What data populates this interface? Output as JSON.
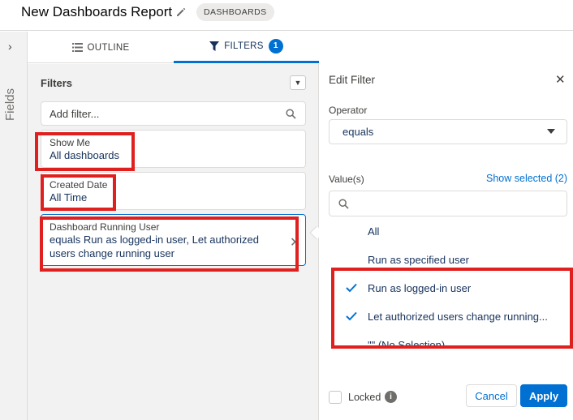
{
  "header": {
    "title": "New Dashboards Report",
    "badge": "DASHBOARDS"
  },
  "sidebar": {
    "fields_label": "Fields"
  },
  "tabs": {
    "outline_label": "OUTLINE",
    "filters_label": "FILTERS",
    "filters_count": "1"
  },
  "filters": {
    "title": "Filters",
    "add_placeholder": "Add filter...",
    "cards": [
      {
        "label": "Show Me",
        "value": "All dashboards"
      },
      {
        "label": "Created Date",
        "value": "All Time"
      },
      {
        "label": "Dashboard Running User",
        "value": "equals Run as logged-in user, Let authorized users change running user"
      }
    ]
  },
  "edit_filter": {
    "title": "Edit Filter",
    "operator_label": "Operator",
    "operator_value": "equals",
    "values_label": "Value(s)",
    "show_selected": "Show selected (2)",
    "options": [
      {
        "label": "All",
        "checked": false
      },
      {
        "label": "Run as specified user",
        "checked": false
      },
      {
        "label": "Run as logged-in user",
        "checked": true
      },
      {
        "label": "Let authorized users change running...",
        "checked": true
      },
      {
        "label": "\"\" (No Selection)",
        "checked": false
      }
    ],
    "locked_label": "Locked",
    "cancel_label": "Cancel",
    "apply_label": "Apply"
  },
  "colors": {
    "accent": "#0070d2",
    "annotation": "#e0201f"
  }
}
